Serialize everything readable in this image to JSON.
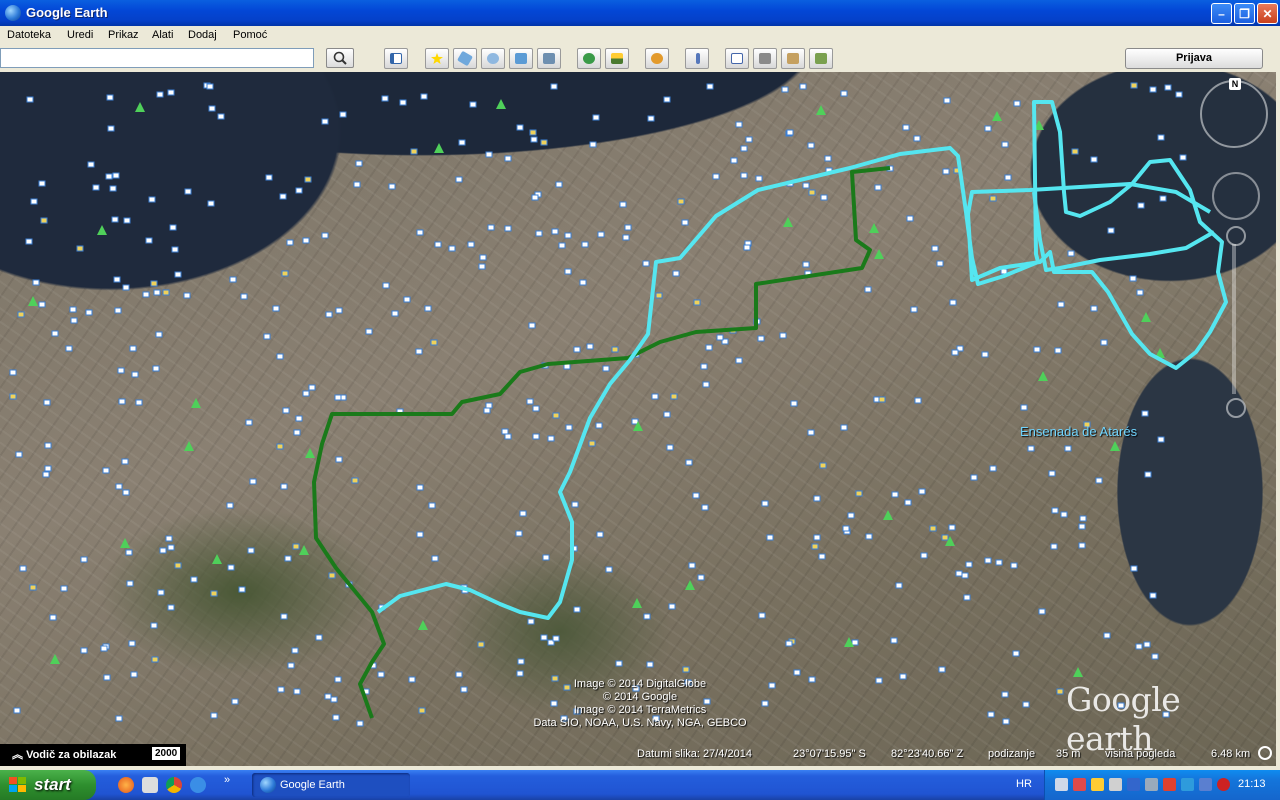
{
  "window": {
    "title": "Google Earth"
  },
  "menu": [
    "Datoteka",
    "Uredi",
    "Prikaz",
    "Alati",
    "Dodaj",
    "Pomoć"
  ],
  "toolbar": {
    "search_value": "",
    "sign_in": "Prijava",
    "icons": [
      "sidebar-toggle-icon",
      "placemark-add-icon",
      "polygon-add-icon",
      "path-add-icon",
      "image-overlay-icon",
      "tour-record-icon",
      "historical-imagery-icon",
      "sunlight-icon",
      "planets-icon",
      "ruler-icon",
      "email-icon",
      "print-icon",
      "save-image-icon",
      "view-in-maps-icon"
    ]
  },
  "map": {
    "place_label": "Ensenada de Atarés",
    "credits": [
      "Image © 2014 DigitalGlobe",
      "© 2014 Google",
      "Image © 2014 TerraMetrics",
      "Data SIO, NOAA, U.S. Navy, NGA, GEBCO"
    ],
    "logo": "Google earth",
    "compass_label": "N",
    "tour_guide": "Vodič za obilazak",
    "historical_year": "2000",
    "route_colors": {
      "cyan": "#55e6f0",
      "green": "#1a7a1a"
    }
  },
  "status": {
    "imagery_date": "Datumi slika: 27/4/2014",
    "lat": "23°07'15.95\" S",
    "lon": "82°23'40.66\" Z",
    "elev_label": "podizanje",
    "elev_value": "35 m",
    "eye_label": "visina pogleda",
    "eye_value": "6.48 km"
  },
  "taskbar": {
    "start_label": "start",
    "task_label": "Google Earth",
    "lang": "HR",
    "clock": "21:13"
  }
}
